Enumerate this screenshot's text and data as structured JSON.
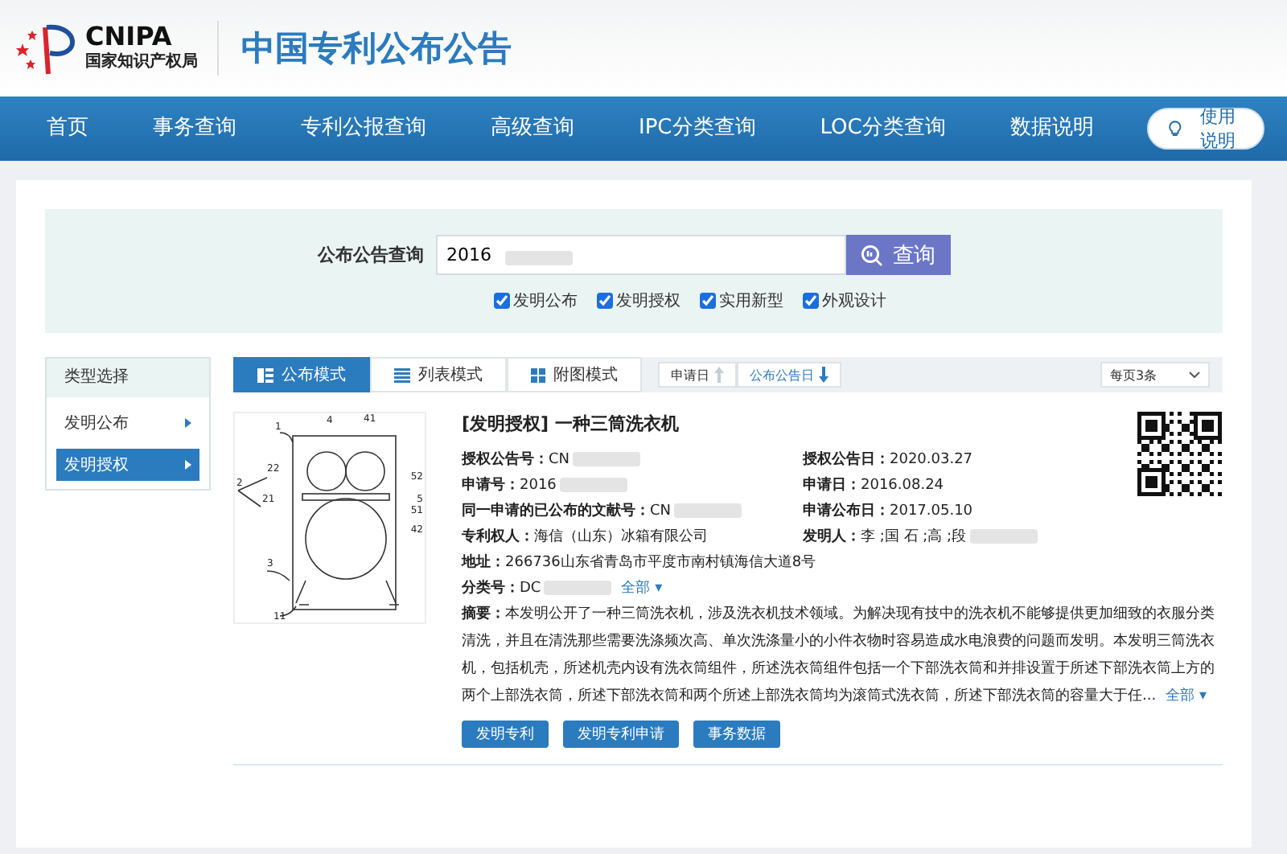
{
  "header": {
    "logo_text": "CNIPA",
    "logo_subtitle": "国家知识产权局",
    "site_title": "中国专利公布公告"
  },
  "nav": {
    "items": [
      {
        "label": "首页",
        "selected": false
      },
      {
        "label": "事务查询",
        "selected": false
      },
      {
        "label": "专利公报查询",
        "selected": false
      },
      {
        "label": "高级查询",
        "selected": false
      },
      {
        "label": "IPC分类查询",
        "selected": false
      },
      {
        "label": "LOC分类查询",
        "selected": false
      },
      {
        "label": "数据说明",
        "selected": false
      }
    ],
    "help_button": "使用说明"
  },
  "search": {
    "label": "公布公告查询",
    "value": "2016",
    "redacted": true,
    "button": "查询",
    "types": [
      {
        "label": "发明公布",
        "checked": true
      },
      {
        "label": "发明授权",
        "checked": true
      },
      {
        "label": "实用新型",
        "checked": true
      },
      {
        "label": "外观设计",
        "checked": true
      }
    ]
  },
  "sidebar": {
    "title": "类型选择",
    "items": [
      {
        "label": "发明公布",
        "selected": false
      },
      {
        "label": "发明授权",
        "selected": true
      }
    ]
  },
  "view_tabs": [
    {
      "label": "公布模式",
      "kind": "publish",
      "selected": true
    },
    {
      "label": "列表模式",
      "kind": "list",
      "selected": false
    },
    {
      "label": "附图模式",
      "kind": "grid",
      "selected": false
    }
  ],
  "sort": [
    {
      "label": "申请日",
      "kind": "up",
      "selected": false
    },
    {
      "label": "公布公告日",
      "kind": "down",
      "selected": true
    }
  ],
  "page_size": "每页3条",
  "result": {
    "title": "[发明授权] 一种三筒洗衣机",
    "figure_labels": [
      "1",
      "4",
      "41",
      "22",
      "2",
      "21",
      "52",
      "5",
      "51",
      "42",
      "3",
      "11"
    ],
    "fields": [
      {
        "text": "**授权公告号：**CN",
        "redacted": true
      },
      {
        "text": "**授权公告日：**2020.03.27",
        "redacted": false
      },
      {
        "text": "**申请号：**2016",
        "redacted": true
      },
      {
        "text": "**申请日：**2016.08.24",
        "redacted": false
      },
      {
        "text": "**同一申请的已公布的文献号：**CN",
        "redacted": true
      },
      {
        "text": "**申请公布日：**2017.05.10",
        "redacted": false
      },
      {
        "text": "**专利权人：**海信（山东）冰箱有限公司",
        "redacted": false
      },
      {
        "text": "**发明人：**李 ;国 石 ;高 ;段",
        "redacted": true
      }
    ],
    "address": "**地址：**266736山东省青岛市平度市南村镇海信大道8号",
    "classification": {
      "text": "**分类号：**DC",
      "redacted": true,
      "more": "全部 ▾"
    },
    "abstract": {
      "text": "**摘要：**本发明公开了一种三筒洗衣机，涉及洗衣机技术领域。为解决现有技中的洗衣机不能够提供更加细致的衣服分类清洗，并且在清洗那些需要洗涤频次高、单次洗涤量小的小件衣物时容易造成水电浪费的问题而发明。本发明三筒洗衣机，包括机壳，所述机壳内设有洗衣筒组件，所述洗衣筒组件包括一个下部洗衣筒和并排设置于所述下部洗衣筒上方的两个上部洗衣筒，所述下部洗衣筒和两个所述上部洗衣筒均为滚筒式洗衣筒，所述下部洗衣筒的容量大于任...",
      "more": "全部 ▾"
    },
    "buttons": [
      "发明专利",
      "发明专利申请",
      "事务数据"
    ]
  }
}
